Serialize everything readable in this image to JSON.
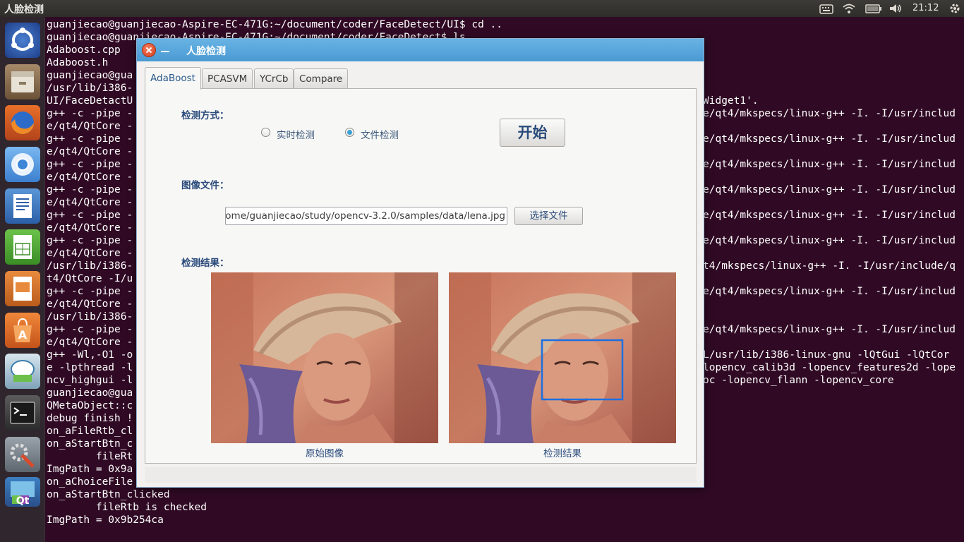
{
  "top_panel": {
    "title": "人脸检测",
    "clock": "21:12",
    "icons": [
      "keyboard-icon",
      "wifi-icon",
      "battery-icon",
      "volume-icon",
      "gear-icon"
    ]
  },
  "launcher": {
    "items": [
      "ubuntu-dash-icon",
      "files-icon",
      "firefox-icon",
      "chromium-icon",
      "writer-icon",
      "calc-icon",
      "impress-icon",
      "software-center-icon",
      "app-icon",
      "terminal-icon",
      "system-settings-icon",
      "qt-creator-icon"
    ]
  },
  "terminal": {
    "lines": [
      "guanjiecao@guanjiecao-Aspire-EC-471G:~/document/coder/FaceDetect/UI$ cd ..",
      "guanjiecao@guanjiecao-Aspire-EC-471G:~/document/coder/FaceDetect$ ls",
      "Adaboost.cpp",
      "Adaboost.h",
      "guanjiecao@gua",
      "/usr/lib/i386-",
      "UI/FaceDetactU",
      "g++ -c -pipe -",
      "e/qt4/QtCore -",
      "g++ -c -pipe -",
      "e/qt4/QtCore -",
      "g++ -c -pipe -",
      "e/qt4/QtCore -",
      "g++ -c -pipe -",
      "e/qt4/QtCore -",
      "g++ -c -pipe -",
      "e/qt4/QtCore -",
      "g++ -c -pipe -",
      "e/qt4/QtCore -",
      "/usr/lib/i386-",
      "t4/QtCore -I/u",
      "g++ -c -pipe -",
      "e/qt4/QtCore -",
      "/usr/lib/i386-",
      "g++ -c -pipe -",
      "e/qt4/QtCore -",
      "g++ -Wl,-O1 -o",
      "e -lpthread -l",
      "ncv_highgui -l",
      "guanjiecao@gua",
      "QMetaObject::c",
      "debug finish !",
      "on_aFileRtb_cl",
      "on_aStartBtn_c",
      "        fileRt",
      "ImgPath = 0x9a",
      "on_aChoiceFile",
      "on_aStartBtn_clicked",
      "        fileRtb is checked",
      "ImgPath = 0x9b254ca"
    ],
    "right_lines": [
      "Widget1'.",
      "e/qt4/mkspecs/linux-g++ -I. -I/usr/includ",
      "",
      "e/qt4/mkspecs/linux-g++ -I. -I/usr/includ",
      "",
      "e/qt4/mkspecs/linux-g++ -I. -I/usr/includ",
      "",
      "e/qt4/mkspecs/linux-g++ -I. -I/usr/includ",
      "",
      "e/qt4/mkspecs/linux-g++ -I. -I/usr/includ",
      "",
      "e/qt4/mkspecs/linux-g++ -I. -I/usr/includ",
      "",
      "t4/mkspecs/linux-g++ -I. -I/usr/include/q",
      "",
      "e/qt4/mkspecs/linux-g++ -I. -I/usr/includ",
      "",
      "",
      "e/qt4/mkspecs/linux-g++ -I. -I/usr/includ",
      "",
      "L/usr/lib/i386-linux-gnu -lQtGui -lQtCor",
      "lopencv_calib3d -lopencv_features2d -lope",
      "oc -lopencv_flann -lopencv_core"
    ]
  },
  "dialog": {
    "title": "人脸检测",
    "tabs": [
      "AdaBoost",
      "PCASVM",
      "YCrCb",
      "Compare"
    ],
    "active_tab": "AdaBoost",
    "detect_mode_label": "检测方式：",
    "radio_realtime": "实时检测",
    "radio_file": "文件检测",
    "selected_mode": "文件检测",
    "start_button": "开始",
    "image_file_label": "图像文件：",
    "file_path": "ome/guanjiecao/study/opencv-3.2.0/samples/data/lena.jpg",
    "choose_file_button": "选择文件",
    "result_label": "检测结果：",
    "original_caption": "原始图像",
    "result_caption": "检测结果"
  }
}
